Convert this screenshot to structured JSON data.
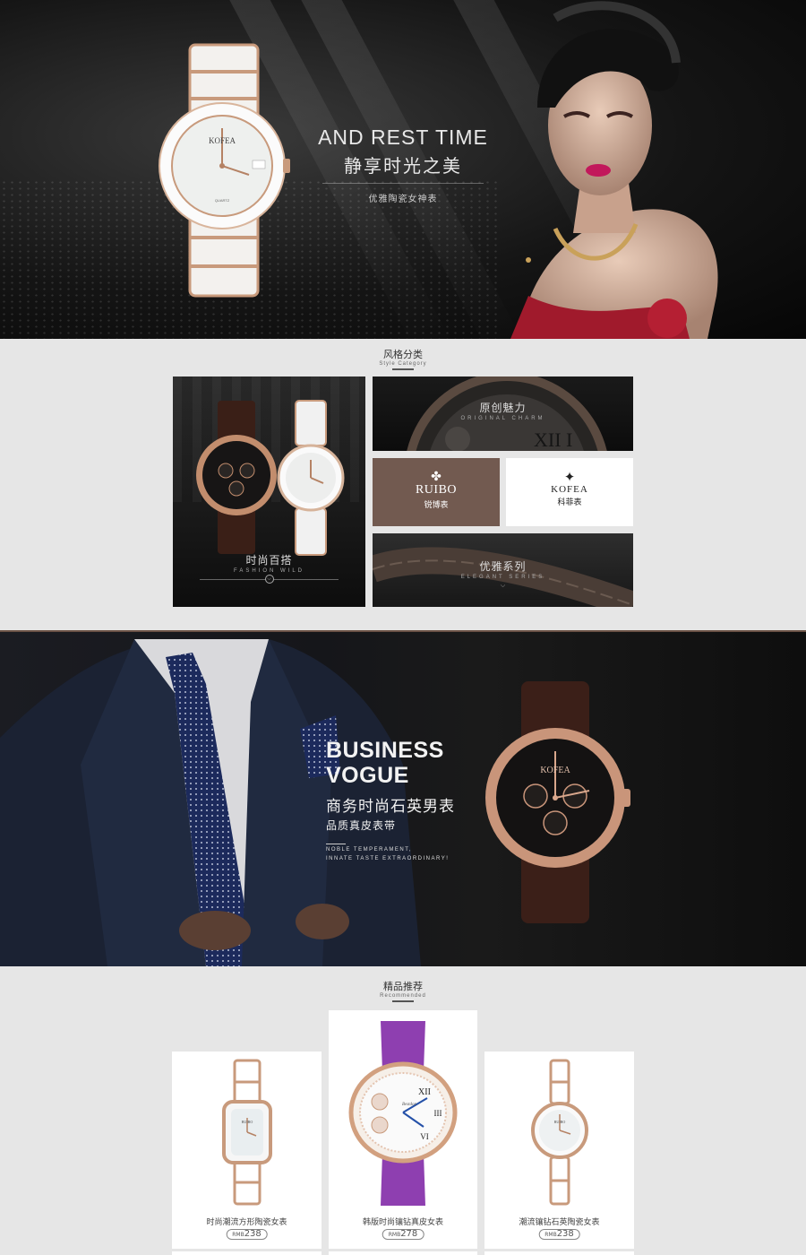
{
  "hero": {
    "title_en": "AND REST TIME",
    "title_cn": "静享时光之美",
    "subtitle_cn": "优雅陶瓷女神表",
    "watch_brand": "KOFEA",
    "watch_dial_text": "QUARTZ"
  },
  "style_section": {
    "title_cn": "风格分类",
    "title_en": "Style Category",
    "fashion": {
      "label_cn": "时尚百搭",
      "label_en": "FASHION WILD",
      "arrow": "⌵"
    },
    "original": {
      "label_cn": "原创魅力",
      "label_en": "ORIGINAL CHARM"
    },
    "ruibo": {
      "name": "RUIBO",
      "name_cn": "锐博表"
    },
    "kofea": {
      "name": "KOFEA",
      "name_cn": "科菲表"
    },
    "elegant": {
      "label_cn": "优雅系列",
      "label_en": "ELEGANT SERIES",
      "arrow": "⌵"
    }
  },
  "business": {
    "title_en_line1": "BUSINESS",
    "title_en_line2": "VOGUE",
    "title_cn": "商务时尚石英男表",
    "subtitle_cn": "品质真皮表带",
    "tagline_line1": "NOBLE TEMPERAMENT,",
    "tagline_line2": "INNATE TASTE EXTRAORDINARY!",
    "watch_brand": "KOFEA"
  },
  "recommended": {
    "title_cn": "精品推荐",
    "title_en": "Recommended",
    "products": [
      {
        "name_cn": "时尚潮流方形陶瓷女表",
        "currency": "RMB",
        "price": "238",
        "brand": "RUIBO"
      },
      {
        "name_cn": "韩版时尚镶钻真皮女表",
        "currency": "RMB",
        "price": "278",
        "brand": "Bestdon"
      },
      {
        "name_cn": "潮流镶钻石英陶瓷女表",
        "currency": "RMB",
        "price": "238",
        "brand": "RUIBO"
      }
    ]
  },
  "colors": {
    "brand_brown": "#725a50",
    "rose_gold": "#c89a7c",
    "purple_strap": "#8e3fb0"
  }
}
